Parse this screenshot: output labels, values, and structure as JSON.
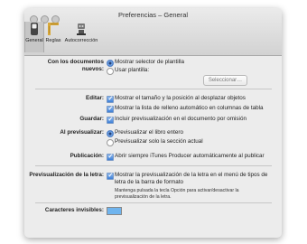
{
  "window": {
    "title": "Preferencias – General"
  },
  "toolbar": {
    "items": [
      {
        "label": "General",
        "icon": "switch-icon"
      },
      {
        "label": "Reglas",
        "icon": "ruler-icon"
      },
      {
        "label": "Autocorrección",
        "icon": "robot-icon"
      }
    ]
  },
  "new_docs": {
    "label": "Con los documentos nuevos:",
    "option_selector": "Mostrar selector de plantilla",
    "option_template": "Usar plantilla:",
    "select_button": "Seleccionar…"
  },
  "edit": {
    "label": "Editar:",
    "show_size": "Mostrar el tamaño y la posición al desplazar objetos",
    "show_autofill": "Mostrar la lista de relleno automático en columnas de tabla"
  },
  "save": {
    "label": "Guardar:",
    "include_preview": "Incluir previsualización en el documento por omisión"
  },
  "preview": {
    "label": "Al previsualizar:",
    "whole_book": "Previsualizar el libro entero",
    "current_section": "Previsualizar solo la sección actual"
  },
  "publish": {
    "label": "Publicación:",
    "open_itunes": "Abrir siempre iTunes Producer automáticamente al publicar"
  },
  "font_preview": {
    "label": "Previsualización de la letra:",
    "show_preview": "Mostrar la previsualización de la letra en el menú de tipos de letra de la barra de formato",
    "hint": "Mantenga pulsada la tecla Opción para activar/desactivar la previsualización de la letra."
  },
  "invisibles": {
    "label": "Caracteres invisibles:",
    "color": "#6fb4ee"
  }
}
